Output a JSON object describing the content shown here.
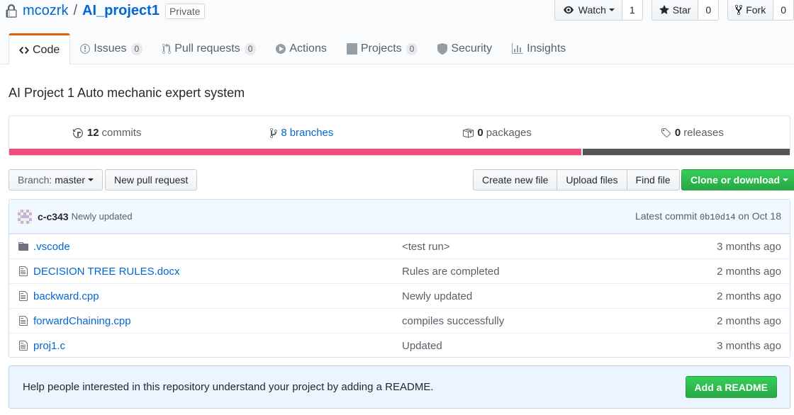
{
  "repo": {
    "owner": "mcozrk",
    "separator": "/",
    "name": "AI_project1",
    "visibility": "Private",
    "description": "AI Project 1 Auto mechanic expert system"
  },
  "actions": {
    "watch_label": "Watch",
    "watch_count": "1",
    "star_label": "Star",
    "star_count": "0",
    "fork_label": "Fork",
    "fork_count": "0"
  },
  "tabs": [
    {
      "label": "Code",
      "icon": "code-icon",
      "selected": true
    },
    {
      "label": "Issues",
      "counter": "0",
      "icon": "issue-icon"
    },
    {
      "label": "Pull requests",
      "counter": "0",
      "icon": "pull-request-icon"
    },
    {
      "label": "Actions",
      "icon": "play-icon"
    },
    {
      "label": "Projects",
      "counter": "0",
      "icon": "project-icon"
    },
    {
      "label": "Security",
      "icon": "shield-icon"
    },
    {
      "label": "Insights",
      "icon": "graph-icon"
    }
  ],
  "summary": {
    "commits_count": "12",
    "commits_label": "commits",
    "branches_count": "8",
    "branches_label": "branches",
    "packages_count": "0",
    "packages_label": "packages",
    "releases_count": "0",
    "releases_label": "releases"
  },
  "language_bar": [
    {
      "color": "#f34b7d",
      "percent": 73.3
    },
    {
      "color": "#555555",
      "percent": 26.7
    }
  ],
  "file_nav": {
    "branch_label": "Branch:",
    "branch_name": "master",
    "new_pr": "New pull request",
    "create_file": "Create new file",
    "upload_files": "Upload files",
    "find_file": "Find file",
    "clone": "Clone or download"
  },
  "latest_commit": {
    "author": "c-c343",
    "message": "Newly updated",
    "prefix": "Latest commit",
    "sha": "0b10d14",
    "date": "on Oct 18"
  },
  "files": [
    {
      "icon": "folder-icon",
      "name": ".vscode",
      "message": "<test run>",
      "age": "3 months ago"
    },
    {
      "icon": "file-icon",
      "name": "DECISION TREE RULES.docx",
      "message": "Rules are completed",
      "age": "2 months ago"
    },
    {
      "icon": "file-icon",
      "name": "backward.cpp",
      "message": "Newly updated",
      "age": "2 months ago"
    },
    {
      "icon": "file-icon",
      "name": "forwardChaining.cpp",
      "message": "compiles successfully",
      "age": "2 months ago"
    },
    {
      "icon": "file-icon",
      "name": "proj1.c",
      "message": "Updated",
      "age": "3 months ago"
    }
  ],
  "readme_notice": {
    "text": "Help people interested in this repository understand your project by adding a README.",
    "button": "Add a README"
  }
}
